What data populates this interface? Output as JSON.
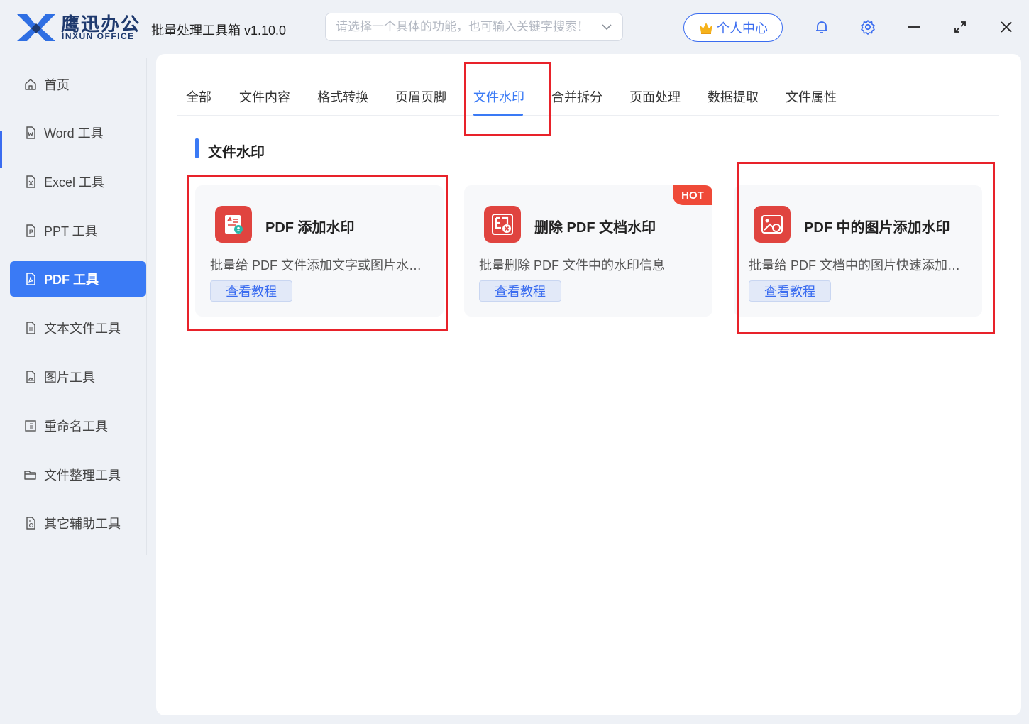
{
  "brand": {
    "name_cn": "鹰迅办公",
    "name_en": "INXUN OFFICE"
  },
  "app": {
    "title": "批量处理工具箱 v1.10.0"
  },
  "search": {
    "placeholder": "请选择一个具体的功能，也可输入关键字搜索！"
  },
  "header": {
    "user_center_label": "个人中心"
  },
  "sidebar": {
    "items": [
      {
        "label": "首页",
        "icon": "home-icon"
      },
      {
        "label": "Word 工具",
        "icon": "word-file-icon"
      },
      {
        "label": "Excel 工具",
        "icon": "excel-file-icon"
      },
      {
        "label": "PPT 工具",
        "icon": "ppt-file-icon"
      },
      {
        "label": "PDF 工具",
        "icon": "pdf-file-icon",
        "active": true
      },
      {
        "label": "文本文件工具",
        "icon": "text-file-icon"
      },
      {
        "label": "图片工具",
        "icon": "image-file-icon"
      },
      {
        "label": "重命名工具",
        "icon": "rename-icon"
      },
      {
        "label": "文件整理工具",
        "icon": "folder-icon"
      },
      {
        "label": "其它辅助工具",
        "icon": "tools-icon"
      }
    ]
  },
  "tabs": [
    {
      "label": "全部"
    },
    {
      "label": "文件内容"
    },
    {
      "label": "格式转换"
    },
    {
      "label": "页眉页脚"
    },
    {
      "label": "文件水印",
      "active": true
    },
    {
      "label": "合并拆分"
    },
    {
      "label": "页面处理"
    },
    {
      "label": "数据提取"
    },
    {
      "label": "文件属性"
    }
  ],
  "section": {
    "title": "文件水印"
  },
  "cards": [
    {
      "title": "PDF 添加水印",
      "desc": "批量给 PDF 文件添加文字或图片水印...",
      "button": "查看教程",
      "icon": "pdf-add-watermark-icon"
    },
    {
      "title": "删除 PDF 文档水印",
      "desc": "批量删除 PDF 文件中的水印信息",
      "button": "查看教程",
      "badge": "HOT",
      "icon": "remove-watermark-icon"
    },
    {
      "title": "PDF 中的图片添加水印",
      "desc": "批量给 PDF 文档中的图片快速添加文...",
      "button": "查看教程",
      "icon": "image-watermark-icon"
    }
  ],
  "colors": {
    "accent": "#3a7af5",
    "highlight": "#e8222a",
    "card_icon": "#e0443f",
    "hot_badge": "#ef4a38"
  }
}
